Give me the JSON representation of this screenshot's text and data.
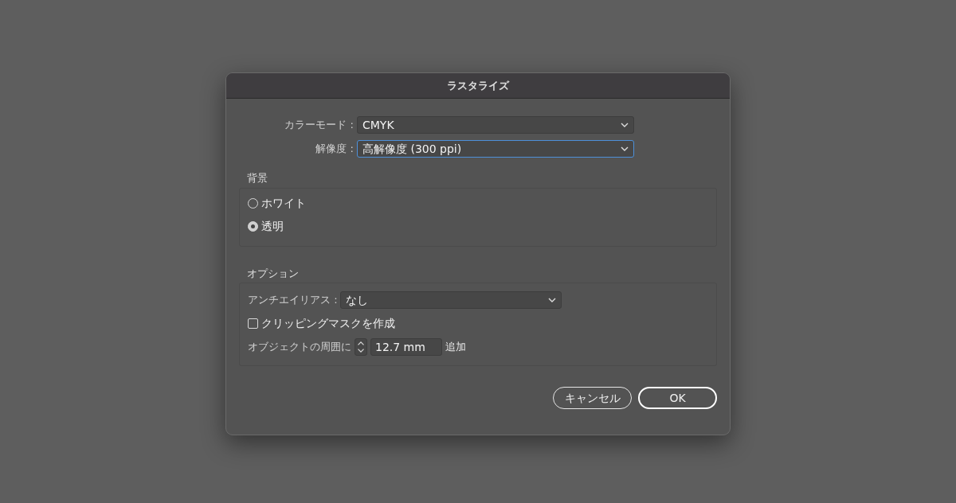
{
  "window": {
    "title": "ラスタライズ"
  },
  "fields": [
    {
      "label": "カラーモード :",
      "value": "CMYK",
      "focused": false
    },
    {
      "label": "解像度 :",
      "value": "高解像度 (300 ppi)",
      "focused": true
    }
  ],
  "background": {
    "title": "背景",
    "options": [
      {
        "label": "ホワイト",
        "selected": false
      },
      {
        "label": "透明",
        "selected": true
      }
    ]
  },
  "options": {
    "title": "オプション",
    "antialias": {
      "label": "アンチエイリアス :",
      "value": "なし"
    },
    "clipping_mask": {
      "label": "クリッピングマスクを作成",
      "checked": false
    },
    "margin": {
      "label": "オブジェクトの周囲に",
      "value": "12.7 mm",
      "suffix": "追加"
    }
  },
  "buttons": [
    {
      "label": "キャンセル",
      "default": false
    },
    {
      "label": "OK",
      "default": true
    }
  ]
}
